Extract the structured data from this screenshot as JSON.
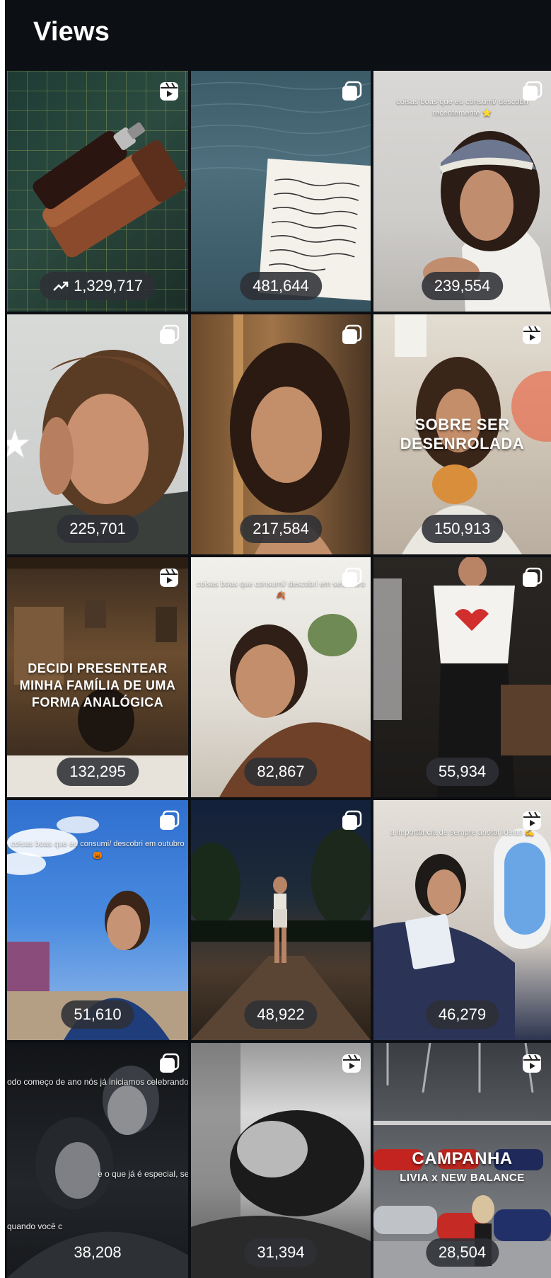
{
  "header": {
    "title": "Views"
  },
  "tiles": [
    {
      "views": "1,329,717",
      "trending": true,
      "type": "reel-icon",
      "overlay": ""
    },
    {
      "views": "481,644",
      "type": "post-icon",
      "overlay": ""
    },
    {
      "views": "239,554",
      "type": "post-icon",
      "overlay": "coisas boas que eu consumi/ descobri recentemente ⭐"
    },
    {
      "views": "225,701",
      "type": "post-icon",
      "overlay": ""
    },
    {
      "views": "217,584",
      "type": "post-icon",
      "overlay": ""
    },
    {
      "views": "150,913",
      "type": "reel-icon",
      "overlay": "SOBRE SER DESENROLADA"
    },
    {
      "views": "132,295",
      "type": "reel-icon",
      "overlay": "DECIDI PRESENTEAR MINHA FAMÍLIA DE UMA FORMA ANALÓGICA"
    },
    {
      "views": "82,867",
      "type": "post-icon",
      "overlay": "coisas boas que consumi/ descobri em setembro 🍂"
    },
    {
      "views": "55,934",
      "type": "post-icon",
      "overlay": ""
    },
    {
      "views": "51,610",
      "type": "post-icon",
      "overlay": "coisas boas que eu consumi/ descobri em outubro 🎃"
    },
    {
      "views": "48,922",
      "type": "post-icon",
      "overlay": ""
    },
    {
      "views": "46,279",
      "type": "reel-icon",
      "overlay": "a importância de sempre anotar ideias ✍️"
    },
    {
      "views": "38,208",
      "type": "post-icon",
      "overlay": "odo começo de ano nós já iniciamos celebrando a s",
      "overlay2": "e o que já é especial, se to",
      "overlay3": "quando você c"
    },
    {
      "views": "31,394",
      "type": "reel-icon",
      "overlay": ""
    },
    {
      "views": "28,504",
      "type": "reel-icon",
      "overlay": "CAMPANHA",
      "overlay2": "LIVIA x NEW BALANCE"
    }
  ],
  "icons": {
    "reel": "reels-icon",
    "post": "multi-post-icon",
    "trend": "trending-up-icon"
  },
  "colors": {
    "panel": "#0c0f13",
    "badge": "#2d3035"
  }
}
